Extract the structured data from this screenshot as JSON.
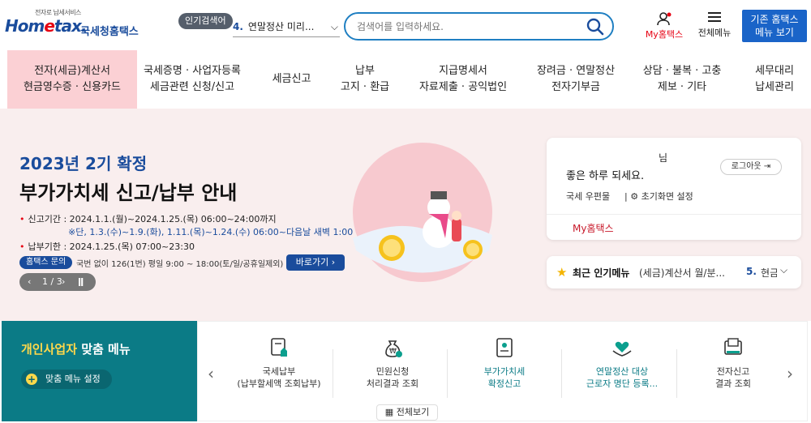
{
  "header": {
    "logo_small": "전자로 납세서비스",
    "logo_brand_a": "Hom",
    "logo_brand_e": "e",
    "logo_brand_b": "tax.",
    "logo_kr": "국세청홈택스",
    "popular_badge": "인기검색어",
    "popular_num": "4.",
    "popular_text": "연말정산 미리...",
    "search_placeholder": "검색어를 입력하세요.",
    "my_hometax": "My홈택스",
    "all_menu": "전체메뉴",
    "old_menu_line1": "기존 홈택스",
    "old_menu_line2": "메뉴 보기"
  },
  "gnb": [
    {
      "line1": "전자(세금)계산서",
      "line2": "현금영수증 · 신용카드",
      "active": true
    },
    {
      "line1": "국세증명 · 사업자등록",
      "line2": "세금관련 신청/신고"
    },
    {
      "line1": "세금신고",
      "line2": ""
    },
    {
      "line1": "납부",
      "line2": "고지 · 환급"
    },
    {
      "line1": "지급명세서",
      "line2": "자료제출 · 공익법인"
    },
    {
      "line1": "장려금 · 연말정산",
      "line2": "전자기부금"
    },
    {
      "line1": "상담 · 불복 · 고충",
      "line2": "제보 · 기타"
    },
    {
      "line1": "세무대리",
      "line2": "납세관리"
    }
  ],
  "banner": {
    "title1": "2023년 2기 확정",
    "title2": "부가가치세 신고/납부 안내",
    "period": "신고기간 : 2024.1.1.(월)~2024.1.25.(목) 06:00~24:00까지",
    "period_note": "※단, 1.3.(수)~1.9.(화), 1.11.(목)~1.24.(수) 06:00~다음날 새벽 1:00",
    "deadline": "납부기한 : 2024.1.25.(목) 07:00~23:30",
    "contact_badge": "홈택스 문의",
    "contact_text": "국번 없이 126(1번) 평일 9:00 ~ 18:00(토/일/공휴일제외)",
    "go_button": "바로가기",
    "pager": "1 / 3"
  },
  "login": {
    "nim": "님",
    "greeting": "좋은 하루 되세요.",
    "logout": "로그아웃",
    "mailbox": "국세 우편물",
    "init_setting": "초기화면 설정",
    "my_hometax": "My홈택스"
  },
  "popular_menu": {
    "title": "최근 인기메뉴",
    "item1": "(세금)계산서 월/분...",
    "item2_num": "5.",
    "item2": "현금"
  },
  "biz": {
    "title_hl": "개인사업자",
    "title_rest": " 맞춤 메뉴",
    "setting": "맞춤 메뉴 설정"
  },
  "quick": [
    {
      "line1": "국세납부",
      "line2": "(납부할세액 조회납부)",
      "icon": "tax-payment-icon"
    },
    {
      "line1": "민원신청",
      "line2": "처리결과 조회",
      "icon": "money-bag-icon"
    },
    {
      "line1": "부가가치세",
      "line2": "확정신고",
      "icon": "vat-report-icon",
      "teal": true
    },
    {
      "line1": "연말정산 대상",
      "line2": "근로자 명단 등록...",
      "icon": "heart-hands-icon",
      "teal": true
    },
    {
      "line1": "전자신고",
      "line2": "결과 조회",
      "icon": "e-filing-icon"
    }
  ],
  "view_all": "전체보기"
}
